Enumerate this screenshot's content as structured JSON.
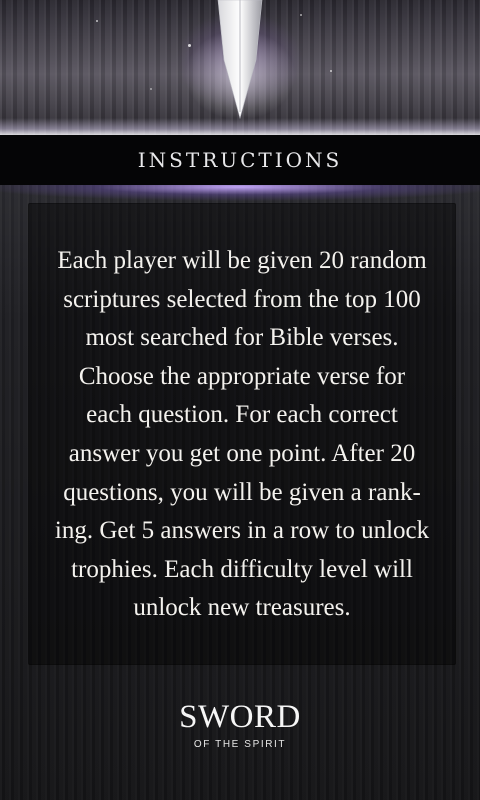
{
  "header": {
    "title": "INSTRUCTIONS"
  },
  "main": {
    "instructions_text": "Each player will be given 20 random\nscriptures selected from the top 100\nmost searched for Bible verses.\nChoose the appropriate verse for\neach question. For each correct\nanswer you get one point. After 20\nquestions, you will be given a rank-\ning. Get 5 answers in a row to unlock\ntrophies. Each difficulty level will\nunlock new treasures."
  },
  "logo": {
    "main": "SWORD",
    "sub": "OF THE SPIRIT"
  },
  "icons": {
    "banner": "sword-icon"
  },
  "colors": {
    "accent_glow": "#c8aaff",
    "title_bar": "#050506",
    "text": "#f4f2ee"
  }
}
